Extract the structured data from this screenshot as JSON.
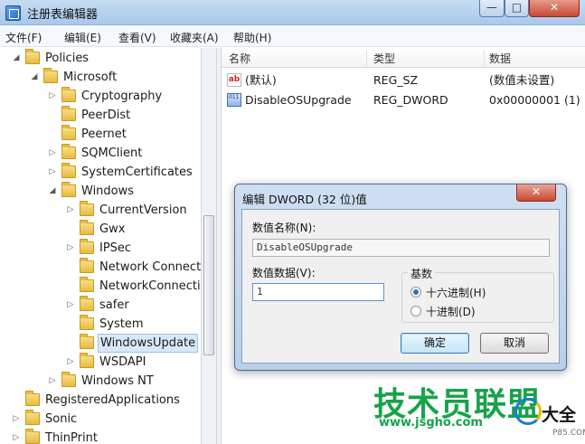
{
  "window": {
    "title": "注册表编辑器",
    "controls": {
      "minimize": "—",
      "maximize": "□",
      "close": "✕"
    }
  },
  "menu": [
    "文件(F)",
    "编辑(E)",
    "查看(V)",
    "收藏夹(A)",
    "帮助(H)"
  ],
  "tree": {
    "items": [
      {
        "label": "Policies",
        "expander": "◢"
      },
      {
        "label": "Microsoft",
        "expander": "◢"
      },
      {
        "label": "Cryptography",
        "expander": "▷"
      },
      {
        "label": "PeerDist",
        "expander": ""
      },
      {
        "label": "Peernet",
        "expander": ""
      },
      {
        "label": "SQMClient",
        "expander": "▷"
      },
      {
        "label": "SystemCertificates",
        "expander": "▷"
      },
      {
        "label": "Windows",
        "expander": "◢"
      },
      {
        "label": "CurrentVersion",
        "expander": "▷"
      },
      {
        "label": "Gwx",
        "expander": ""
      },
      {
        "label": "IPSec",
        "expander": "▷"
      },
      {
        "label": "Network Connecti",
        "expander": ""
      },
      {
        "label": "NetworkConnectiv",
        "expander": ""
      },
      {
        "label": "safer",
        "expander": "▷"
      },
      {
        "label": "System",
        "expander": ""
      },
      {
        "label": "WindowsUpdate",
        "expander": ""
      },
      {
        "label": "WSDAPI",
        "expander": "▷"
      },
      {
        "label": "Windows NT",
        "expander": "▷"
      },
      {
        "label": "RegisteredApplications",
        "expander": ""
      },
      {
        "label": "Sonic",
        "expander": "▷"
      },
      {
        "label": "ThinPrint",
        "expander": "▷"
      }
    ],
    "selected": "WindowsUpdate"
  },
  "list": {
    "columns": [
      "名称",
      "类型",
      "数据"
    ],
    "rows": [
      {
        "icon": "string-value-icon",
        "icon_text": "ab",
        "name": "(默认)",
        "type": "REG_SZ",
        "data": "(数值未设置)"
      },
      {
        "icon": "dword-value-icon",
        "name": "DisableOSUpgrade",
        "type": "REG_DWORD",
        "data": "0x00000001 (1)"
      }
    ]
  },
  "dialog": {
    "title": "编辑 DWORD (32 位)值",
    "close": "✕",
    "value_name_label": "数值名称(N):",
    "value_name": "DisableOSUpgrade",
    "value_data_label": "数值数据(V):",
    "value_data": "1",
    "base_label": "基数",
    "base_options": [
      {
        "label": "十六进制(H)",
        "selected": true
      },
      {
        "label": "十进制(D)",
        "selected": false
      }
    ],
    "ok": "确定",
    "cancel": "取消"
  },
  "watermark": {
    "main": "技术员联盟",
    "url": "www.jsgho.com",
    "sub": "大全",
    "tiny": "P85.COM"
  },
  "colors": {
    "accent": "#16a34a",
    "titlebar": "#b7d1ee",
    "selection": "#d8e8f8"
  }
}
